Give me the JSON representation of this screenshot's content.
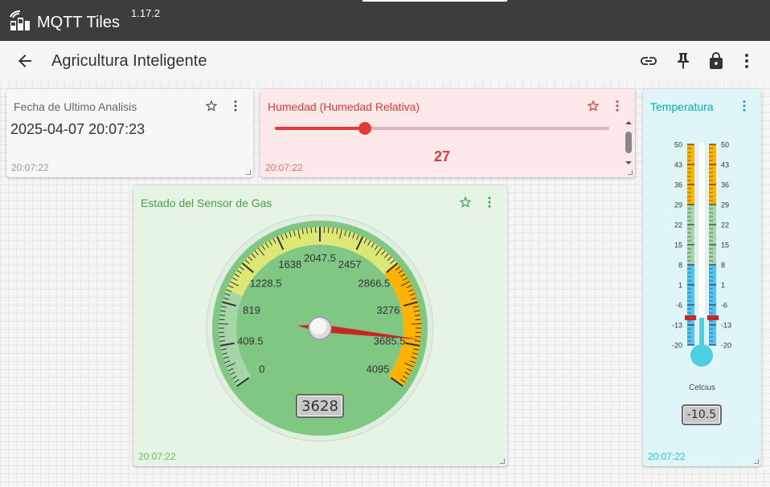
{
  "app": {
    "name": "MQTT Tiles",
    "version": "1.17.2"
  },
  "toolbar": {
    "title": "Agricultura Inteligente",
    "icons": [
      "back-arrow-icon",
      "link-icon",
      "pin-icon",
      "lock-icon",
      "more-vert-icon"
    ]
  },
  "tiles": {
    "fecha": {
      "title": "Fecha de Ultimo Analisis",
      "value": "2025-04-07 20:07:23",
      "time": "20:07:22"
    },
    "humedad": {
      "title": "Humedad (Humedad Relativa)",
      "value": "27",
      "slider_fraction": 0.27,
      "time": "20:07:22",
      "accent": "#e53935"
    },
    "gas": {
      "title": "Estado del Sensor de Gas",
      "value": "3628",
      "time": "20:07:22",
      "gauge": {
        "min": 0,
        "max": 4095,
        "value": 3628,
        "labels": [
          "0",
          "409.5",
          "819",
          "1228.5",
          "1638",
          "2047.5",
          "2457",
          "2866.5",
          "3276",
          "3685.5",
          "4095"
        ],
        "colors": {
          "background": "#81c784",
          "low": "#a5d6a7",
          "mid": "#dce775",
          "high": "#ffb300",
          "needle": "#c62828"
        }
      }
    },
    "temperatura": {
      "title": "Temperatura",
      "value": "-10.5",
      "unit": "Celcius",
      "time": "20:07:22",
      "scale": {
        "min": -20,
        "max": 50,
        "value": -10.5,
        "labels": [
          "50",
          "43",
          "36",
          "29",
          "22",
          "15",
          "8",
          "1",
          "-6",
          "-13",
          "-20"
        ]
      },
      "colors": {
        "high": "#ffb300",
        "mid": "#a5d6a7",
        "low": "#4fc3f7",
        "bulb": "#4dd0e1",
        "marker": "#c62828"
      }
    }
  }
}
